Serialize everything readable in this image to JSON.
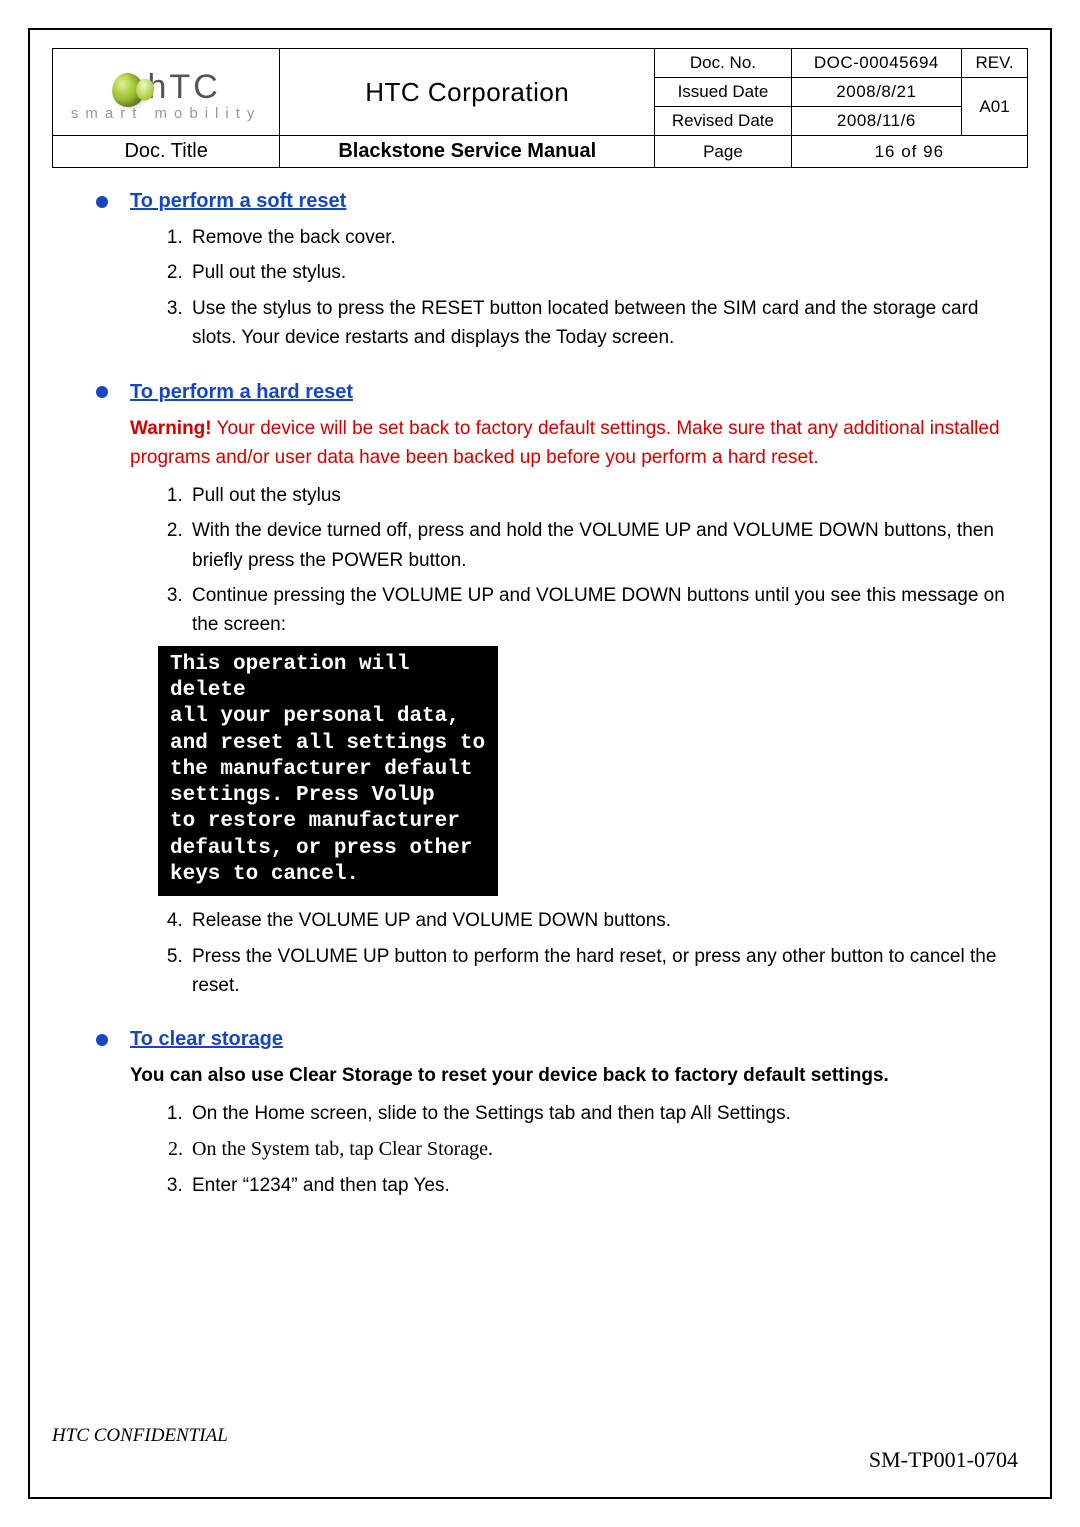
{
  "header": {
    "corp": "HTC Corporation",
    "logo_sub": "smart mobility",
    "docno_label": "Doc. No.",
    "docno": "DOC-00045694",
    "rev_label": "REV.",
    "rev": "A01",
    "issued_label": "Issued Date",
    "issued": "2008/8/21",
    "revised_label": "Revised Date",
    "revised": "2008/11/6",
    "title_label": "Doc. Title",
    "doc_title": "Blackstone Service Manual",
    "page_label": "Page",
    "page": "16 of 96"
  },
  "soft": {
    "title": "To perform a soft reset",
    "s1": "Remove the back cover.",
    "s2": "Pull out the stylus.",
    "s3": "Use the stylus to press the RESET button located between the SIM card and the storage card slots. Your device restarts and displays the Today screen."
  },
  "hard": {
    "title": "To perform a hard reset",
    "warn_label": "Warning!",
    "warn_text": " Your device will be set back to factory default settings. Make sure that any additional installed programs and/or user data have been backed up before you perform a hard reset.",
    "s1": "Pull out the stylus",
    "s2": "With the device turned off, press and hold the VOLUME UP and VOLUME DOWN buttons, then briefly press the POWER button.",
    "s3": "Continue pressing the VOLUME UP and VOLUME DOWN buttons until you see this message on the screen:",
    "screen_msg": "This operation will delete\nall your personal data,\nand reset all settings to\nthe manufacturer default\nsettings. Press VolUp\nto restore manufacturer\ndefaults, or press other\nkeys to cancel.",
    "s4": "Release the VOLUME UP and VOLUME DOWN buttons.",
    "s5": "Press the VOLUME UP button to perform the hard reset, or press any other button to cancel the reset."
  },
  "clear": {
    "title": "To clear storage",
    "note": "You can also use Clear Storage to reset your device back to factory default settings.",
    "s1": "On the Home screen, slide to the Settings tab and then tap All Settings.",
    "s2": "On the System tab, tap Clear Storage.",
    "s3": "Enter “1234” and then tap Yes."
  },
  "footer": {
    "conf": "HTC CONFIDENTIAL",
    "code": "SM-TP001-0704"
  }
}
